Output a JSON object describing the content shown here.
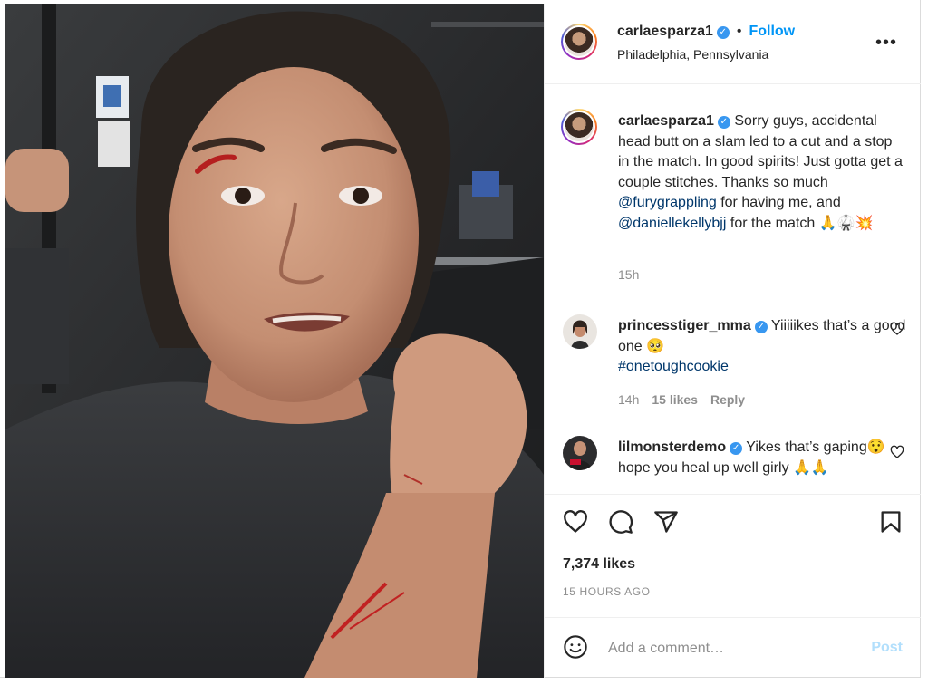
{
  "post": {
    "username": "carlaesparza1",
    "location": "Philadelphia, Pennsylvania",
    "follow_label": "Follow",
    "separator": "•",
    "more_label": "•••",
    "caption": {
      "username": "carlaesparza1",
      "text_1": "Sorry guys, accidental head butt on a slam led to a cut and a stop in the match. In good spirits! Just gotta get a couple stitches. Thanks so much",
      "mention_1": "@furygrappling",
      "text_2": "for having me, and",
      "mention_2": "@daniellekellybjj",
      "text_3": "for the match 🙏🥋💥",
      "time": "15h"
    },
    "comments": [
      {
        "username": "princesstiger_mma",
        "text": "Yiiiiikes that’s a good one 🥺",
        "hashtag": "#onetoughcookie",
        "time": "14h",
        "likes": "15 likes",
        "reply": "Reply"
      },
      {
        "username": "lilmonsterdemo",
        "text": "Yikes that’s gaping😯 hope you heal up well girly 🙏🙏"
      }
    ],
    "likes": "7,374 likes",
    "timestamp": "15 HOURS AGO",
    "add_comment_placeholder": "Add a comment…",
    "post_label": "Post"
  },
  "icons": {
    "verified": "verified-badge-icon",
    "like": "heart-icon",
    "comment": "comment-bubble-icon",
    "share": "paper-plane-icon",
    "save": "bookmark-icon",
    "emoji": "smiley-icon",
    "more": "more-options-icon"
  },
  "colors": {
    "link": "#0095f6",
    "mention": "#00376b",
    "secondary_text": "#8e8e8e",
    "verified": "#3897f0",
    "post_disabled": "#b2dffc"
  }
}
